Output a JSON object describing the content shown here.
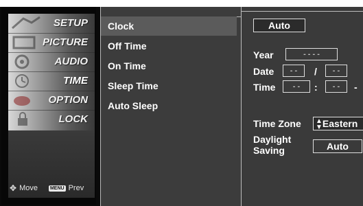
{
  "sidebar": {
    "items": [
      {
        "label": "SETUP"
      },
      {
        "label": "PICTURE"
      },
      {
        "label": "AUDIO"
      },
      {
        "label": "TIME"
      },
      {
        "label": "OPTION"
      },
      {
        "label": "LOCK"
      }
    ],
    "active_index": 3,
    "footer": {
      "move_label": "Move",
      "menu_key": "MENU",
      "prev_label": "Prev"
    }
  },
  "submenu": {
    "items": [
      {
        "label": "Clock",
        "selected": true
      },
      {
        "label": "Off Time",
        "selected": false
      },
      {
        "label": "On Time",
        "selected": false
      },
      {
        "label": "Sleep Time",
        "selected": false
      },
      {
        "label": "Auto Sleep",
        "selected": false
      }
    ]
  },
  "clock": {
    "mode_value": "Auto",
    "year_label": "Year",
    "year_value": "- - - -",
    "date_label": "Date",
    "date_month": "- -",
    "date_sep": "/",
    "date_day": "- -",
    "time_label": "Time",
    "time_hour": "- -",
    "time_sep": ":",
    "time_min": "- -",
    "time_trail": "-",
    "timezone_label": "Time Zone",
    "timezone_value": "Eastern",
    "daylight_label_line1": "Daylight",
    "daylight_label_line2": "Saving",
    "daylight_value": "Auto"
  },
  "colors": {
    "panel_bg": "#3a3a3a",
    "selected_bg": "#5b5b5b",
    "border": "#e0e0e0"
  }
}
